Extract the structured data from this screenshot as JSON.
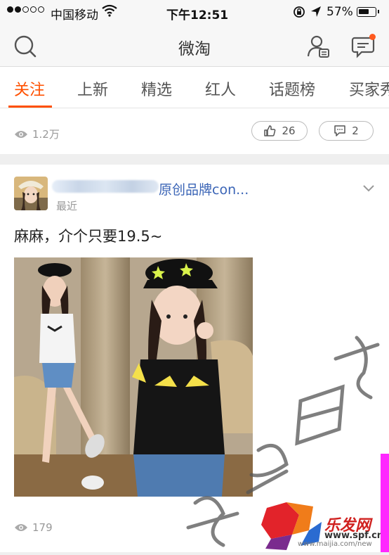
{
  "status_bar": {
    "carrier": "中国移动",
    "time": "下午12:51",
    "battery": "57%"
  },
  "header": {
    "title": "微淘"
  },
  "tabs": [
    {
      "label": "关注",
      "active": true
    },
    {
      "label": "上新"
    },
    {
      "label": "精选"
    },
    {
      "label": "红人"
    },
    {
      "label": "话题榜"
    },
    {
      "label": "买家秀"
    }
  ],
  "post_prev": {
    "views": "1.2万",
    "likes": "26",
    "comments": "2"
  },
  "post": {
    "shop_name": "原创品牌con...",
    "time_label": "最近",
    "text": "麻麻，介个只要19.5~",
    "views": "179"
  },
  "watermark": {
    "brand": "乐发网",
    "url": "www.spf.cn",
    "url2": "www.maijia.com/new"
  },
  "colors": {
    "accent": "#ff5000",
    "link": "#3a64b6",
    "badge": "#ff5a1f"
  }
}
